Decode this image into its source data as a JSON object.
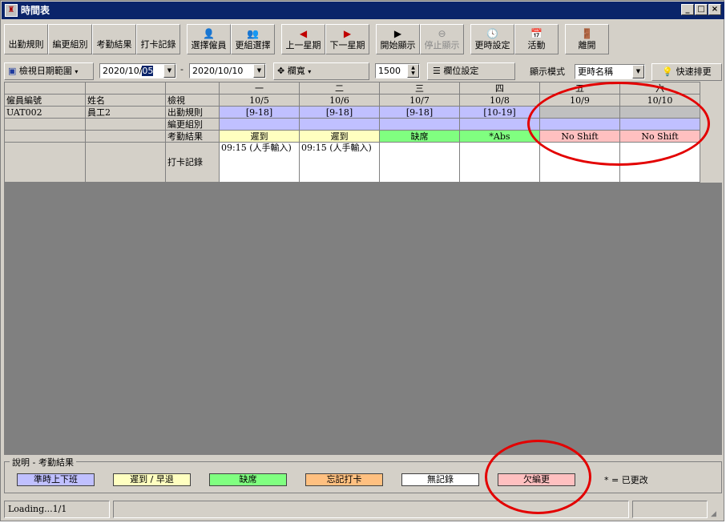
{
  "window": {
    "title": "時間表",
    "min": "_",
    "max": "□",
    "close": "×"
  },
  "toolbar": {
    "tabs": [
      "出勤規則",
      "編更組別",
      "考勤結果",
      "打卡記錄"
    ],
    "select_employee": "選擇僱員",
    "shift_group_select": "更組選擇",
    "prev_week": "上一星期",
    "next_week": "下一星期",
    "start_display": "開始顯示",
    "stop_display": "停止顯示",
    "shift_setting": "更時設定",
    "activity": "活動",
    "leave": "離開"
  },
  "filters": {
    "view_range": "檢視日期範圍",
    "date_from_prefix": "2020/10/",
    "date_from_sel": "05",
    "dash": "-",
    "date_to": "2020/10/10",
    "width_label": "欄寬",
    "width_value": "1500",
    "column_settings": "欄位設定",
    "display_mode_label": "顯示模式",
    "display_mode_value": "更時名稱",
    "quick_shift": "快速排更"
  },
  "grid": {
    "header_weekdays": [
      "一",
      "二",
      "三",
      "四",
      "五",
      "六"
    ],
    "col_emp_no": "僱員編號",
    "col_name": "姓名",
    "col_view": "檢視",
    "dates": [
      "10/5",
      "10/6",
      "10/7",
      "10/8",
      "10/9",
      "10/10"
    ],
    "employee": {
      "id": "UAT002",
      "name": "員工2"
    },
    "row_labels": {
      "rule": "出勤規則",
      "group": "編更組別",
      "result": "考勤結果",
      "punch": "打卡記錄"
    },
    "rules": [
      "[9-18]",
      "[9-18]",
      "[9-18]",
      "[10-19]",
      "",
      ""
    ],
    "results": [
      "遲到",
      "遲到",
      "缺席",
      "*Abs",
      "No Shift",
      "No Shift"
    ],
    "result_colors": [
      "#ffffc0",
      "#ffffc0",
      "#80ff80",
      "#80ff80",
      "#ffc0c0",
      "#ffc0c0"
    ],
    "punches": [
      "09:15 (人手輸入)",
      "09:15 (人手輸入)",
      "",
      "",
      "",
      ""
    ]
  },
  "legend": {
    "caption": "說明 - 考勤結果",
    "items": [
      {
        "label": "準時上下班",
        "color": "#c0c0ff"
      },
      {
        "label": "遲到 / 早退",
        "color": "#ffffc0"
      },
      {
        "label": "缺席",
        "color": "#80ff80"
      },
      {
        "label": "忘記打卡",
        "color": "#ffc080"
      },
      {
        "label": "無記錄",
        "color": "#ffffff"
      },
      {
        "label": "欠編更",
        "color": "#ffc0c0"
      }
    ],
    "changed_note": "* = 已更改"
  },
  "status": {
    "text": "Loading...1/1"
  }
}
